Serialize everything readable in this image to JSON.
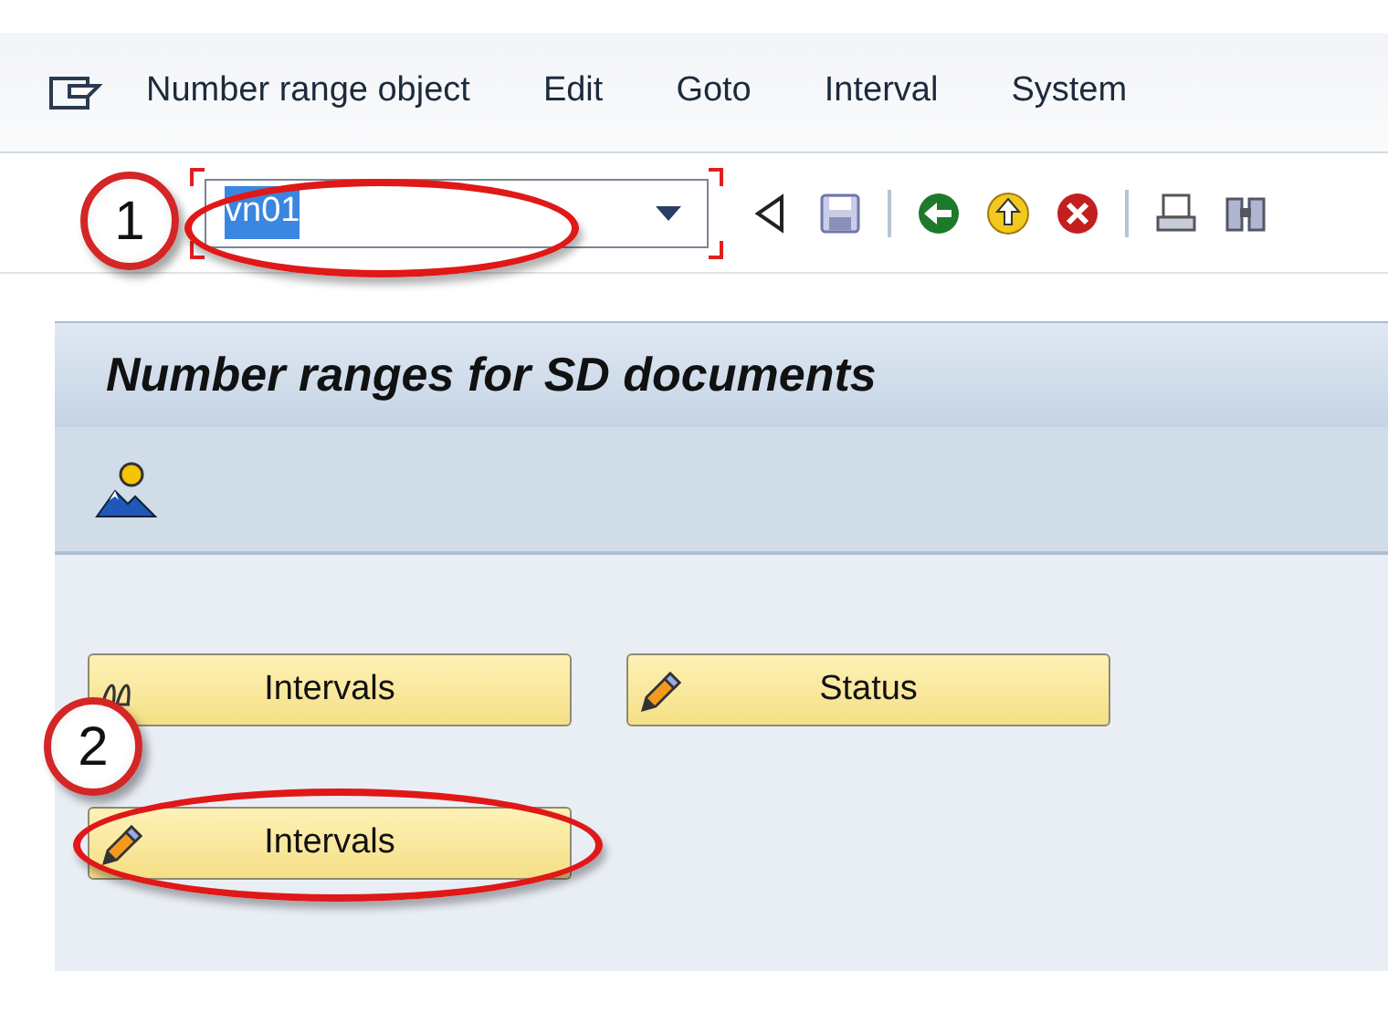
{
  "menu_bar": [
    {
      "label": "Number range object"
    },
    {
      "label": "Edit"
    },
    {
      "label": "Goto"
    },
    {
      "label": "Interval"
    },
    {
      "label": "System"
    }
  ],
  "command_field": {
    "value": "vn01",
    "selected_text": true
  },
  "title": "Number ranges for SD documents",
  "buttons": [
    [
      {
        "label": "Intervals",
        "kind": "display"
      },
      {
        "label": "Status",
        "kind": "change"
      }
    ],
    [
      {
        "label": "Intervals",
        "kind": "change"
      }
    ]
  ],
  "callouts": [
    {
      "label": "1"
    },
    {
      "label": "2"
    }
  ]
}
